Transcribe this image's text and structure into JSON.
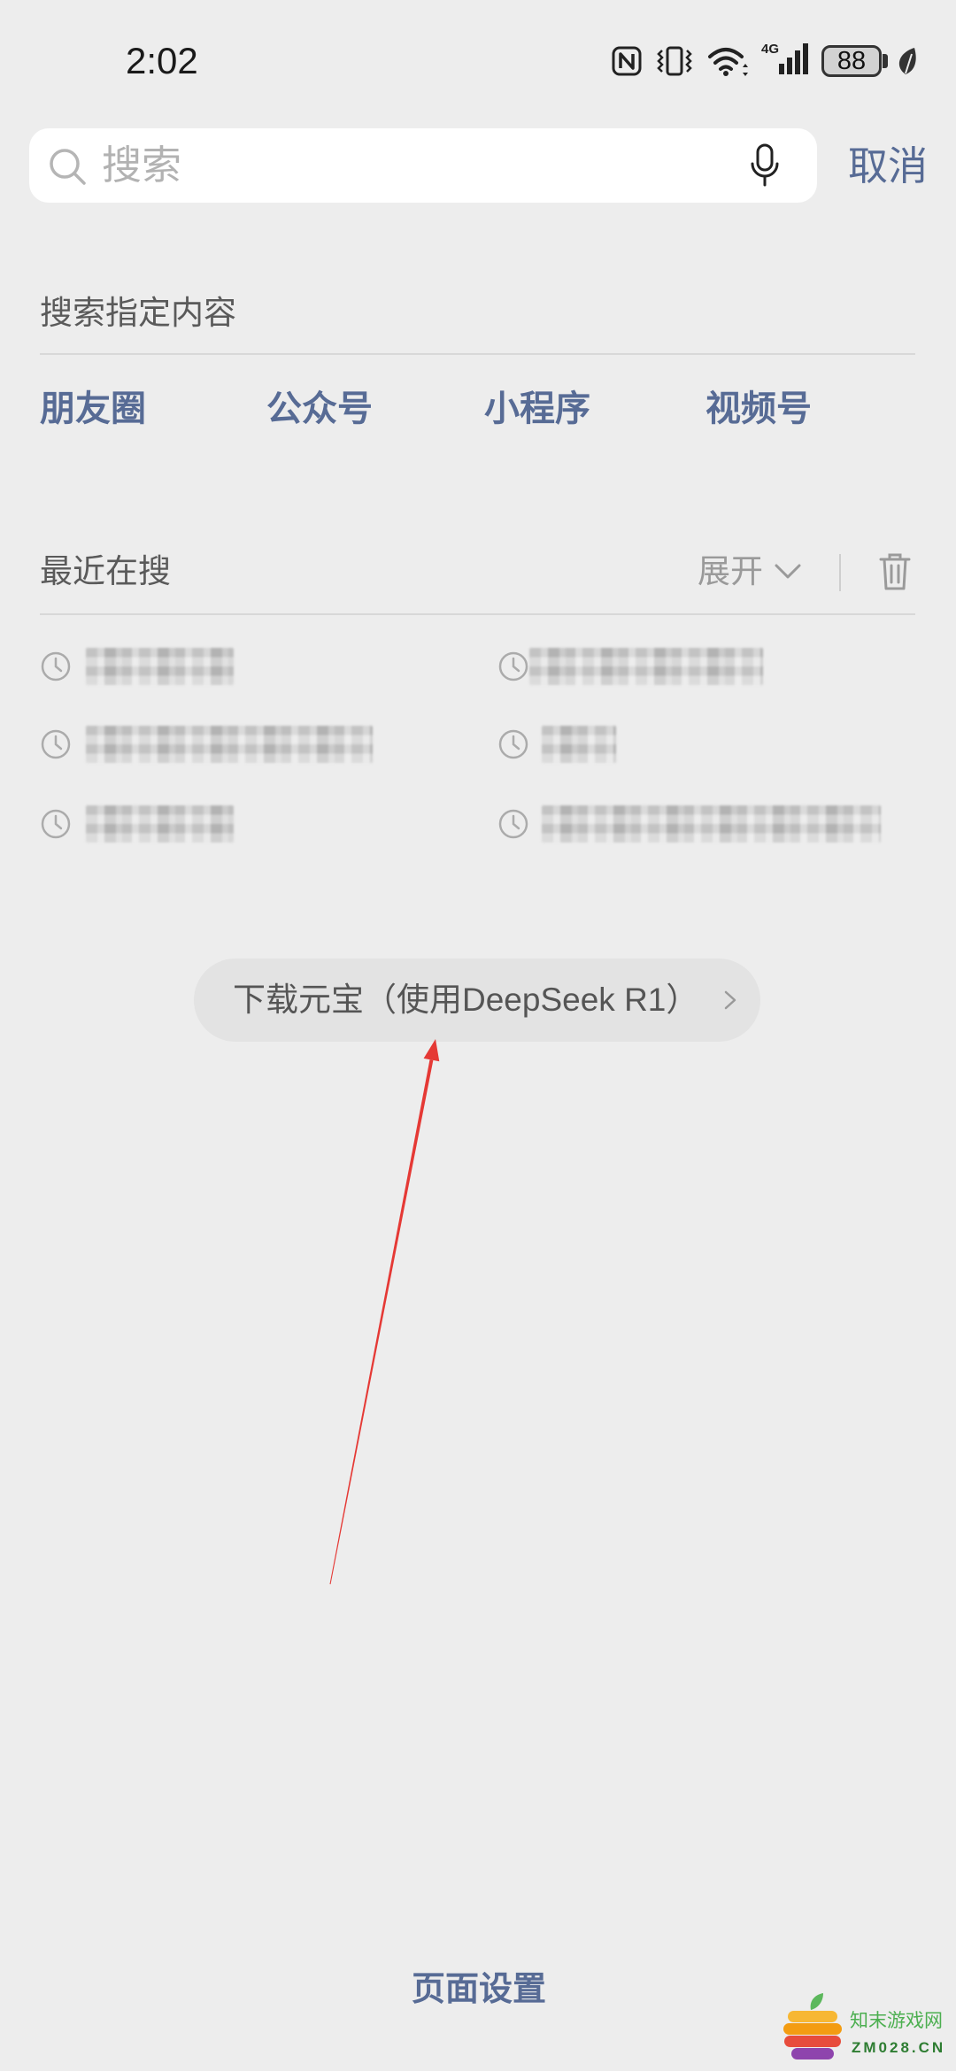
{
  "status_bar": {
    "time": "2:02",
    "network": "4G",
    "battery_level": "88"
  },
  "search": {
    "placeholder": "搜索",
    "cancel_label": "取消"
  },
  "specified_content": {
    "title": "搜索指定内容",
    "categories": [
      "朋友圈",
      "公众号",
      "小程序",
      "视频号"
    ]
  },
  "recent_searches": {
    "title": "最近在搜",
    "expand_label": "展开"
  },
  "promo": {
    "label": "下载元宝（使用DeepSeek R1）"
  },
  "footer": {
    "page_settings_label": "页面设置"
  },
  "watermark": {
    "name": "知末游戏网",
    "domain": "ZM028.CN"
  },
  "icons": {
    "status": [
      "nfc-icon",
      "vibrate-icon",
      "wifi-icon",
      "signal-icon",
      "battery-icon",
      "leaf-icon"
    ],
    "search": "search-icon",
    "voice": "microphone-icon",
    "expand": "chevron-down-icon",
    "clear_history": "trash-icon",
    "history_item": "clock-icon",
    "promo": "chevron-right-icon"
  },
  "colors": {
    "background": "#ededed",
    "surface": "#ffffff",
    "link": "#576b95",
    "secondary_text": "#5a5a5a",
    "muted_text": "#9a9a9a",
    "pill": "#e3e3e3",
    "annotation": "#e53935"
  }
}
